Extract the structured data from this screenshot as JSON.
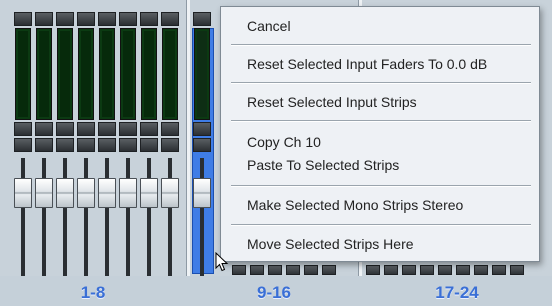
{
  "banks": [
    {
      "label": "1-8"
    },
    {
      "label": "9-16"
    },
    {
      "label": "17-24"
    }
  ],
  "context_menu": {
    "items": [
      {
        "label": "Cancel"
      },
      {
        "label": "Reset Selected Input Faders To 0.0 dB"
      },
      {
        "label": "Reset Selected Input Strips"
      },
      {
        "label": "Copy Ch 10"
      },
      {
        "label": "Paste To Selected Strips"
      },
      {
        "label": "Make Selected Mono Strips Stereo"
      },
      {
        "label": "Move Selected Strips Here"
      }
    ]
  },
  "colors": {
    "accent": "#3a6fd6",
    "selected_strip": "#3f7de6",
    "meter": "#062a0b"
  },
  "icons": {
    "cursor": "arrow-cursor-icon"
  }
}
